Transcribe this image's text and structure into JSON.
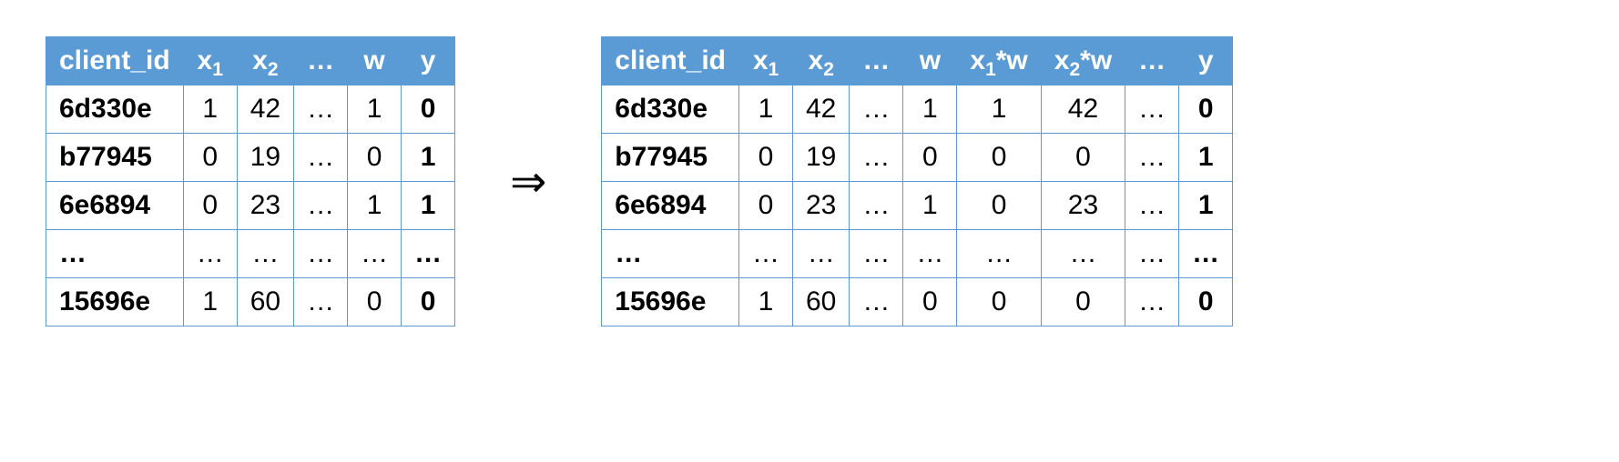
{
  "arrow": "⇒",
  "left": {
    "headers": {
      "client_id": "client_id",
      "x1_base": "x",
      "x1_sub": "1",
      "x2_base": "x",
      "x2_sub": "2",
      "dots": "…",
      "w": "w",
      "y": "y"
    },
    "rows": [
      {
        "client_id": "6d330e",
        "x1": "1",
        "x2": "42",
        "dots": "…",
        "w": "1",
        "y": "0"
      },
      {
        "client_id": "b77945",
        "x1": "0",
        "x2": "19",
        "dots": "…",
        "w": "0",
        "y": "1"
      },
      {
        "client_id": "6e6894",
        "x1": "0",
        "x2": "23",
        "dots": "…",
        "w": "1",
        "y": "1"
      },
      {
        "client_id": "…",
        "x1": "…",
        "x2": "…",
        "dots": "…",
        "w": "…",
        "y": "…"
      },
      {
        "client_id": "15696e",
        "x1": "1",
        "x2": "60",
        "dots": "…",
        "w": "0",
        "y": "0"
      }
    ]
  },
  "right": {
    "headers": {
      "client_id": "client_id",
      "x1_base": "x",
      "x1_sub": "1",
      "x2_base": "x",
      "x2_sub": "2",
      "dots1": "…",
      "w": "w",
      "x1w_base": "x",
      "x1w_sub": "1",
      "x1w_tail": "*w",
      "x2w_base": "x",
      "x2w_sub": "2",
      "x2w_tail": "*w",
      "dots2": "…",
      "y": "y"
    },
    "rows": [
      {
        "client_id": "6d330e",
        "x1": "1",
        "x2": "42",
        "d1": "…",
        "w": "1",
        "x1w": "1",
        "x2w": "42",
        "d2": "…",
        "y": "0"
      },
      {
        "client_id": "b77945",
        "x1": "0",
        "x2": "19",
        "d1": "…",
        "w": "0",
        "x1w": "0",
        "x2w": "0",
        "d2": "…",
        "y": "1"
      },
      {
        "client_id": "6e6894",
        "x1": "0",
        "x2": "23",
        "d1": "…",
        "w": "1",
        "x1w": "0",
        "x2w": "23",
        "d2": "…",
        "y": "1"
      },
      {
        "client_id": "…",
        "x1": "…",
        "x2": "…",
        "d1": "…",
        "w": "…",
        "x1w": "…",
        "x2w": "…",
        "d2": "…",
        "y": "…"
      },
      {
        "client_id": "15696e",
        "x1": "1",
        "x2": "60",
        "d1": "…",
        "w": "0",
        "x1w": "0",
        "x2w": "0",
        "d2": "…",
        "y": "0"
      }
    ]
  }
}
